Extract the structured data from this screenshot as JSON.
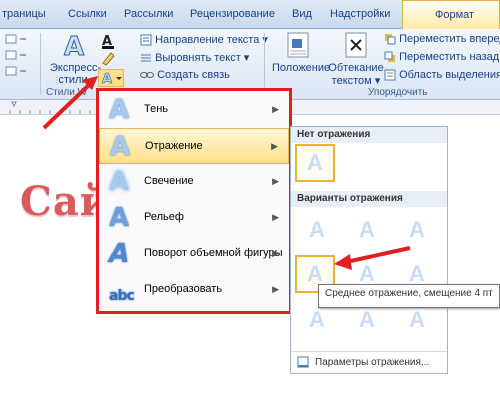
{
  "tabs": [
    "траницы",
    "Ссылки",
    "Рассылки",
    "Рецензирование",
    "Вид",
    "Надстройки"
  ],
  "active_tab": "Формат",
  "ribbon": {
    "express_styles_line1": "Экспресс-",
    "express_styles_line2": "стили",
    "text_direction": "Направление текста",
    "align_text": "Выровнять текст",
    "create_link": "Создать связь",
    "position": "Положение",
    "wrap_line1": "Обтекание",
    "wrap_line2": "текстом",
    "bring_forward": "Переместить вперед",
    "send_backward": "Переместить назад",
    "selection_pane": "Область выделения",
    "group_styles": "Стили W",
    "group_arrange": "Упорядочить"
  },
  "document": {
    "text": "Сай"
  },
  "menu": {
    "items": [
      {
        "label": "Тень"
      },
      {
        "label": "Отражение"
      },
      {
        "label": "Свечение"
      },
      {
        "label": "Рельеф"
      },
      {
        "label": "Поворот объемной фигуры"
      },
      {
        "label": "Преобразовать"
      }
    ],
    "highlighted": "Отражение"
  },
  "submenu": {
    "no_reflection": "Нет отражения",
    "variants": "Варианты отражения",
    "footer": "Параметры отражения...",
    "glyph": "A"
  },
  "tooltip": "Среднее отражение, смещение 4 пт",
  "colors": {
    "accent_red": "#e02020",
    "highlight": "#ffe08a",
    "ribbon_blue": "#dbe6f4"
  }
}
